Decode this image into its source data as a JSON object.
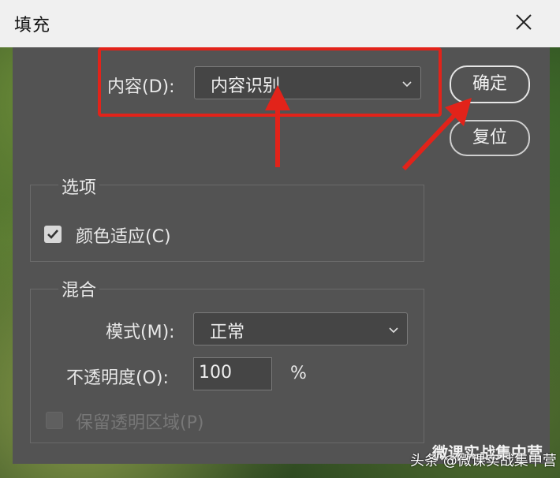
{
  "window": {
    "title": "填充"
  },
  "content": {
    "label": "内容(D):",
    "selected": "内容识别"
  },
  "buttons": {
    "ok": "确定",
    "reset": "复位"
  },
  "options": {
    "group_title": "选项",
    "color_adapt": {
      "label": "颜色适应(C)",
      "checked": true
    }
  },
  "blend": {
    "group_title": "混合",
    "mode_label": "模式(M):",
    "mode_value": "正常",
    "opacity_label": "不透明度(O):",
    "opacity_value": "100",
    "opacity_unit": "%",
    "preserve": {
      "label": "保留透明区域(P)",
      "checked": false,
      "enabled": false
    }
  },
  "watermark": {
    "text": "微课实战集中营",
    "caption": "头条 @微课实战集中营"
  },
  "colors": {
    "highlight": "#e2231a",
    "dialog_bg": "#535353",
    "titlebar": "#f0f0f0"
  }
}
